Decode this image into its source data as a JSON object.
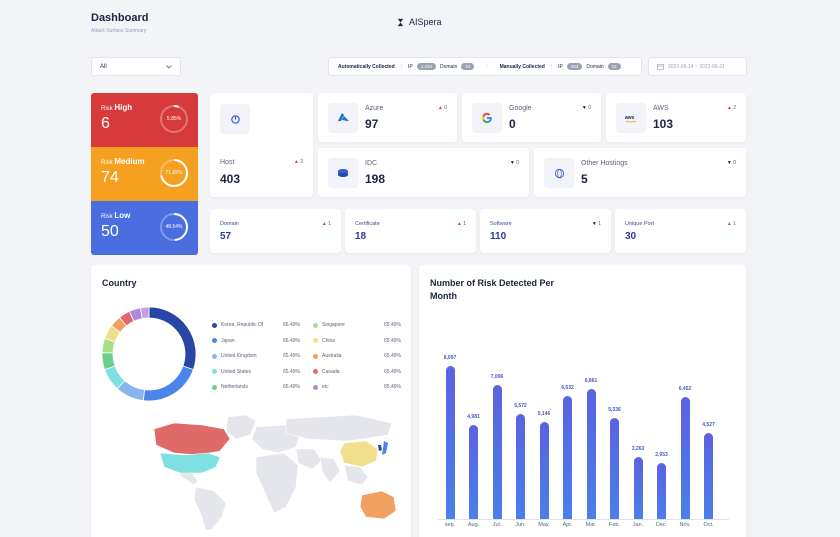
{
  "header": {
    "title": "Dashboard",
    "subtitle": "Attack Surface Summary",
    "brand": "AISpera"
  },
  "filters": {
    "select_value": "All",
    "auto_label": "Automatically Collected",
    "auto_ip_label": "IP",
    "auto_ip_count": "1,234",
    "auto_domain_label": "Domain",
    "auto_domain_count": "34",
    "manual_label": "Manually Collected",
    "manual_ip_label": "IP",
    "manual_ip_count": "453",
    "manual_domain_label": "Domain",
    "manual_domain_count": "24",
    "date_range": "2022-06-14 ~ 2022-06-21"
  },
  "risk": [
    {
      "prefix": "Risk",
      "level": "High",
      "count": "6",
      "percent": "5.85%",
      "fraction": 0.0585,
      "color": "#d63a3a"
    },
    {
      "prefix": "Risk",
      "level": "Medium",
      "count": "74",
      "percent": "71.65%",
      "fraction": 0.7165,
      "color": "#f5a020"
    },
    {
      "prefix": "Risk",
      "level": "Low",
      "count": "50",
      "percent": "48.54%",
      "fraction": 0.4854,
      "color": "#4a6ee0"
    }
  ],
  "stats": {
    "host": {
      "name": "Host",
      "value": "403",
      "delta": "2",
      "icon": "host-icon"
    },
    "azure": {
      "name": "Azure",
      "value": "97",
      "delta": "0",
      "icon": "azure-icon"
    },
    "google": {
      "name": "Google",
      "value": "0",
      "delta": "0",
      "icon": "google-icon"
    },
    "aws": {
      "name": "AWS",
      "value": "103",
      "delta": "2",
      "icon": "aws-icon"
    },
    "idc": {
      "name": "IDC",
      "value": "198",
      "delta": "0",
      "icon": "idc-icon"
    },
    "other": {
      "name": "Other Hostings",
      "value": "5",
      "delta": "0",
      "icon": "globe-icon"
    },
    "domain": {
      "name": "Domain",
      "value": "57",
      "delta": "1"
    },
    "certificate": {
      "name": "Certificate",
      "value": "18",
      "delta": "1"
    },
    "software": {
      "name": "Software",
      "value": "110",
      "delta": "1"
    },
    "port": {
      "name": "Unique Port",
      "value": "30",
      "delta": "1"
    }
  },
  "country": {
    "title": "Country",
    "legend": [
      {
        "name": "Korea, Republic Of",
        "pct": "65.49%",
        "color": "#2845a8"
      },
      {
        "name": "Singapore",
        "pct": "65.49%",
        "color": "#a6e08c"
      },
      {
        "name": "Japan",
        "pct": "65.49%",
        "color": "#4a86e8"
      },
      {
        "name": "China",
        "pct": "65.49%",
        "color": "#f0e08c"
      },
      {
        "name": "United Kingdom",
        "pct": "65.49%",
        "color": "#8ab4f0"
      },
      {
        "name": "Australia",
        "pct": "65.49%",
        "color": "#f0a060"
      },
      {
        "name": "United States",
        "pct": "65.49%",
        "color": "#7ee0e0"
      },
      {
        "name": "Canada",
        "pct": "65.49%",
        "color": "#e06a6a"
      },
      {
        "name": "Netherlands",
        "pct": "65.49%",
        "color": "#6cd08c"
      },
      {
        "name": "etc",
        "pct": "65.49%",
        "color": "#b088e0"
      }
    ],
    "donut": [
      0.31,
      0.22,
      0.1,
      0.08,
      0.06,
      0.05,
      0.05,
      0.04,
      0.04,
      0.04,
      0.03
    ]
  },
  "chart_data": {
    "type": "bar",
    "title": "Number of Risk Detected Per Month",
    "categories": [
      "sep.",
      "Aug.",
      "Jul.",
      "Jun.",
      "May.",
      "Apr.",
      "Mar.",
      "Feb.",
      "Jan.",
      "Dec.",
      "Nov.",
      "Oct."
    ],
    "values": [
      8097,
      4981,
      7096,
      5572,
      5146,
      6532,
      6861,
      5336,
      3263,
      2953,
      6452,
      4527
    ],
    "labels": [
      "8,097",
      "4,981",
      "7,096",
      "5,572",
      "5,146",
      "6,532",
      "6,861",
      "5,336",
      "3,263",
      "2,953",
      "6,452",
      "4,527"
    ],
    "ylim": [
      0,
      9000
    ],
    "bar_color": "#5566dd"
  }
}
